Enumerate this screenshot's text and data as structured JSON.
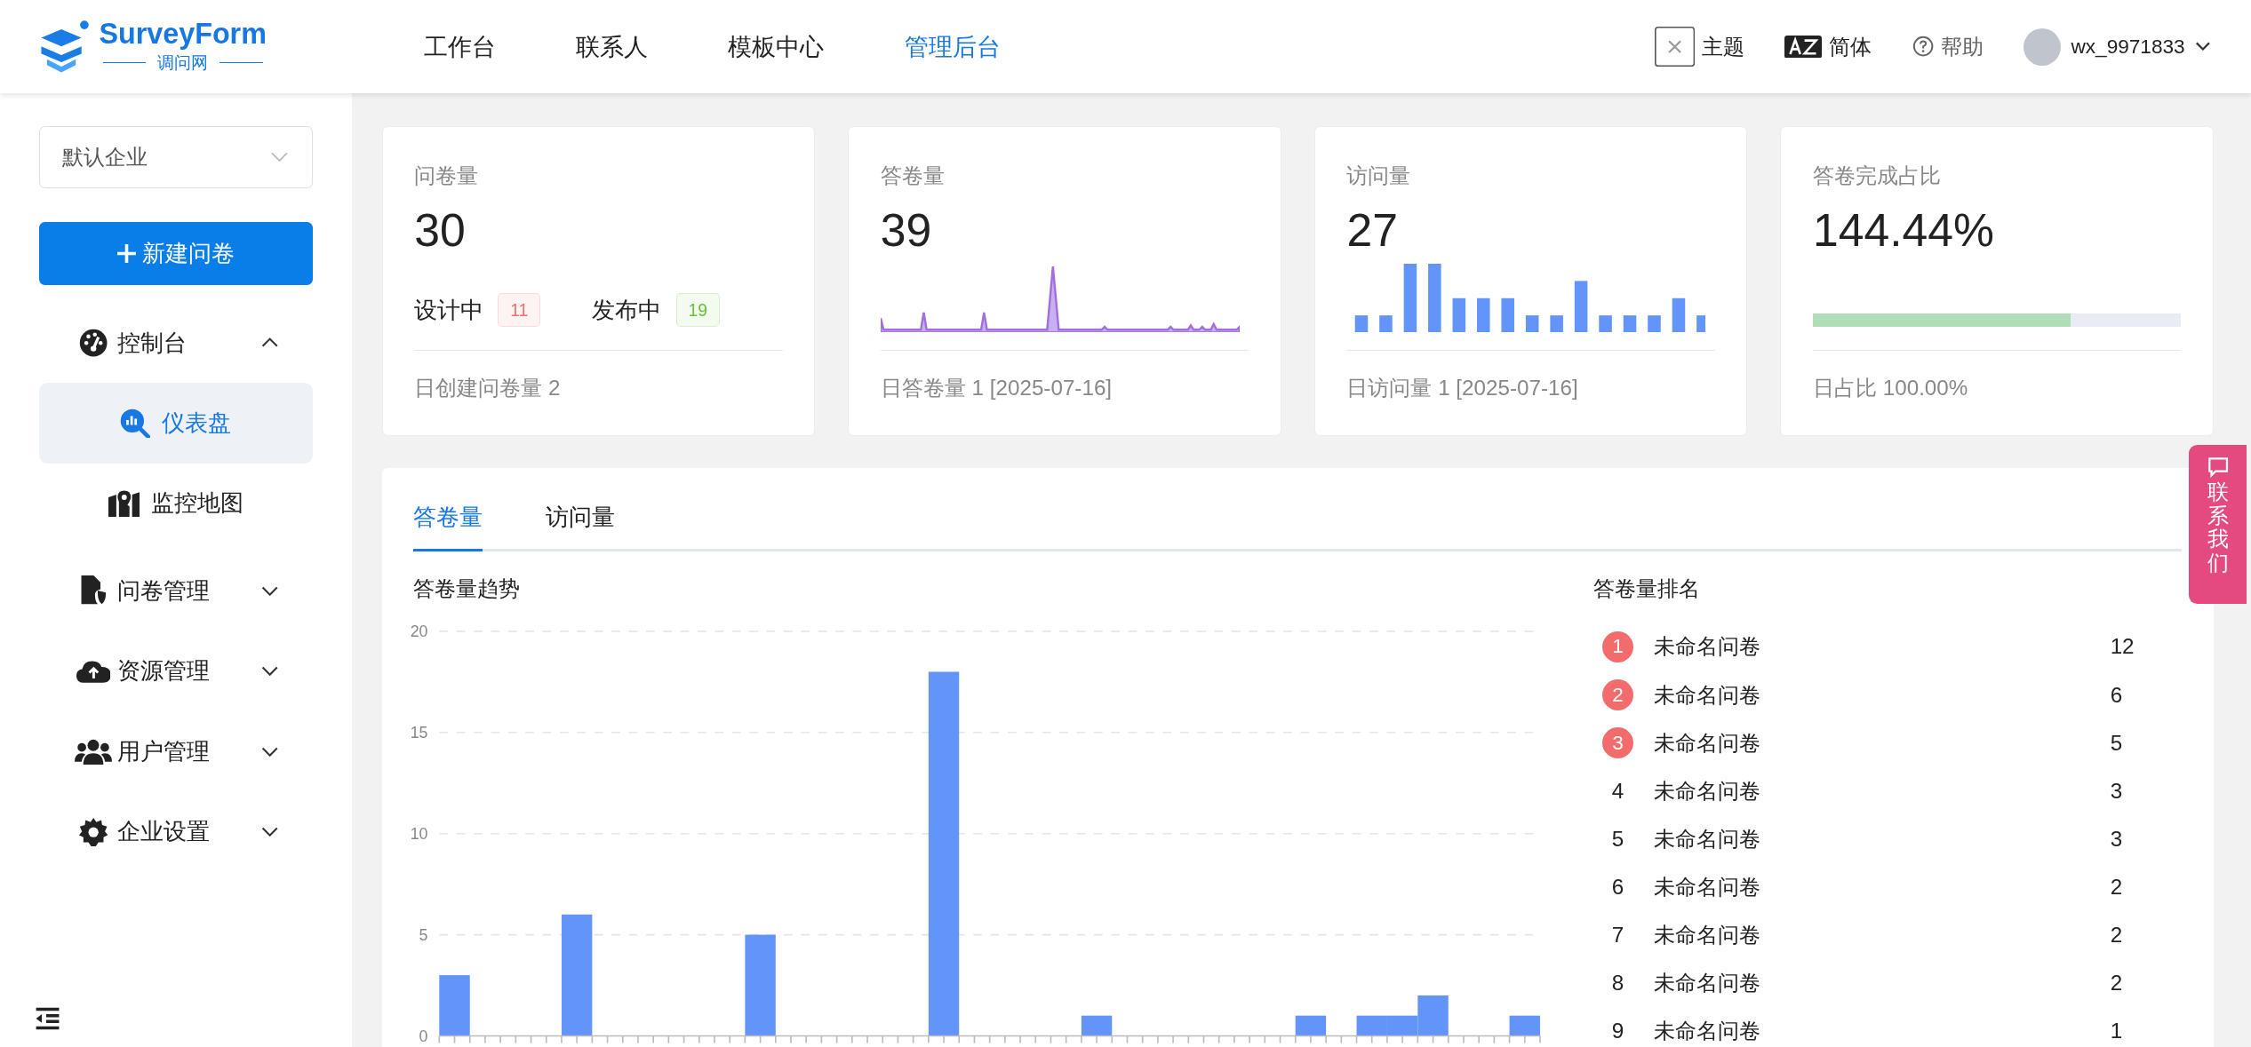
{
  "header": {
    "logo": {
      "title": "SurveyForm",
      "subtitle": "调问网"
    },
    "nav": [
      {
        "label": "工作台",
        "selected": false
      },
      {
        "label": "联系人",
        "selected": false
      },
      {
        "label": "模板中心",
        "selected": false
      },
      {
        "label": "管理后台",
        "selected": true
      }
    ],
    "tools": [
      {
        "label": "主题"
      },
      {
        "label": "简体"
      },
      {
        "label": "帮助"
      }
    ],
    "user": {
      "name": "wx_9971833"
    }
  },
  "sidebar": {
    "company_select": {
      "value": "默认企业"
    },
    "new_button": "新建问卷",
    "menu": [
      {
        "label": "控制台",
        "expanded": true,
        "children": [
          {
            "label": "仪表盘",
            "selected": true
          },
          {
            "label": "监控地图",
            "selected": false
          }
        ]
      },
      {
        "label": "问卷管理",
        "expanded": false
      },
      {
        "label": "资源管理",
        "expanded": false
      },
      {
        "label": "用户管理",
        "expanded": false
      },
      {
        "label": "企业设置",
        "expanded": false
      }
    ]
  },
  "stats": [
    {
      "kind": "tags",
      "title": "问卷量",
      "value": "30",
      "tags": [
        {
          "label": "设计中",
          "count": "11",
          "color": "#f56c6c"
        },
        {
          "label": "发布中",
          "count": "19",
          "color": "#67c23a"
        }
      ],
      "footer": "日创建问卷量 2"
    },
    {
      "kind": "sparkline",
      "title": "答卷量",
      "value": "39",
      "footer": "日答卷量 1 [2025-07-16]"
    },
    {
      "kind": "minibars",
      "title": "访问量",
      "value": "27",
      "footer": "日访问量 1 [2025-07-16]"
    },
    {
      "kind": "progress",
      "title": "答卷完成占比",
      "value": "144.44%",
      "level": 0.7,
      "footer": "日占比 100.00%"
    }
  ],
  "panel": {
    "tabs": [
      {
        "label": "答卷量",
        "selected": true
      },
      {
        "label": "访问量",
        "selected": false
      }
    ],
    "trend": {
      "title": "答卷量趋势",
      "chart_data": {
        "type": "bar",
        "grid": true,
        "ylim": [
          0,
          20
        ],
        "yticks": [
          0,
          5,
          10,
          15,
          20
        ],
        "values": [
          3,
          0,
          0,
          0,
          6,
          0,
          0,
          0,
          0,
          0,
          5,
          0,
          0,
          0,
          0,
          0,
          18,
          0,
          0,
          0,
          0,
          1,
          0,
          0,
          0,
          0,
          0,
          0,
          1,
          0,
          1,
          1,
          2,
          0,
          0,
          1
        ]
      }
    },
    "ranking": {
      "title": "答卷量排名",
      "rows": [
        {
          "kind": "medal",
          "rank": "1",
          "name": "未命名问卷",
          "count": "12"
        },
        {
          "kind": "medal",
          "rank": "2",
          "name": "未命名问卷",
          "count": "6"
        },
        {
          "kind": "medal",
          "rank": "3",
          "name": "未命名问卷",
          "count": "5"
        },
        {
          "kind": "plain",
          "rank": "4",
          "name": "未命名问卷",
          "count": "3"
        },
        {
          "kind": "plain",
          "rank": "5",
          "name": "未命名问卷",
          "count": "3"
        },
        {
          "kind": "plain",
          "rank": "6",
          "name": "未命名问卷",
          "count": "2"
        },
        {
          "kind": "plain",
          "rank": "7",
          "name": "未命名问卷",
          "count": "2"
        },
        {
          "kind": "plain",
          "rank": "8",
          "name": "未命名问卷",
          "count": "2"
        },
        {
          "kind": "plain",
          "rank": "9",
          "name": "未命名问卷",
          "count": "1"
        }
      ]
    }
  },
  "contact": {
    "label": "联系我们"
  }
}
